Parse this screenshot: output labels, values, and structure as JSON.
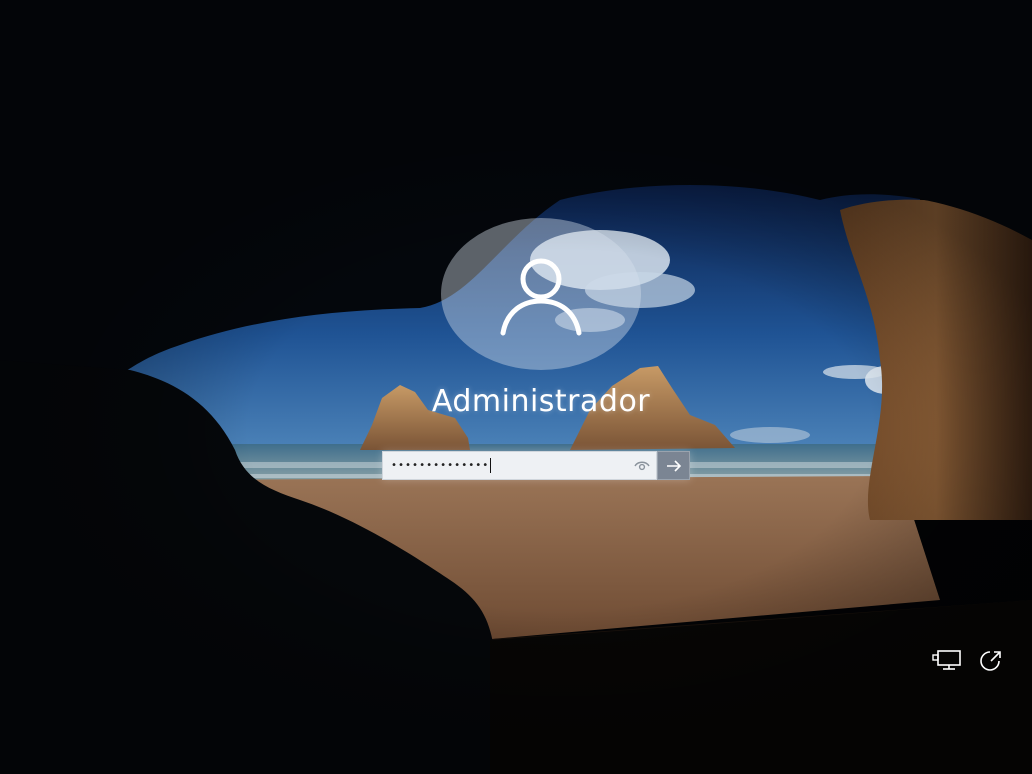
{
  "lock_screen": {
    "user_name": "Administrador",
    "password_value": "••••••••••••••",
    "icons": {
      "avatar": "user-icon",
      "reveal": "eye-icon",
      "submit": "arrow-right-icon",
      "network": "network-icon",
      "accessibility": "ease-of-access-icon"
    },
    "colors": {
      "avatar_circle": "#d7e1eb",
      "field_background": "#eef1f4",
      "submit_button": "#7b8593",
      "text": "#ffffff"
    }
  }
}
